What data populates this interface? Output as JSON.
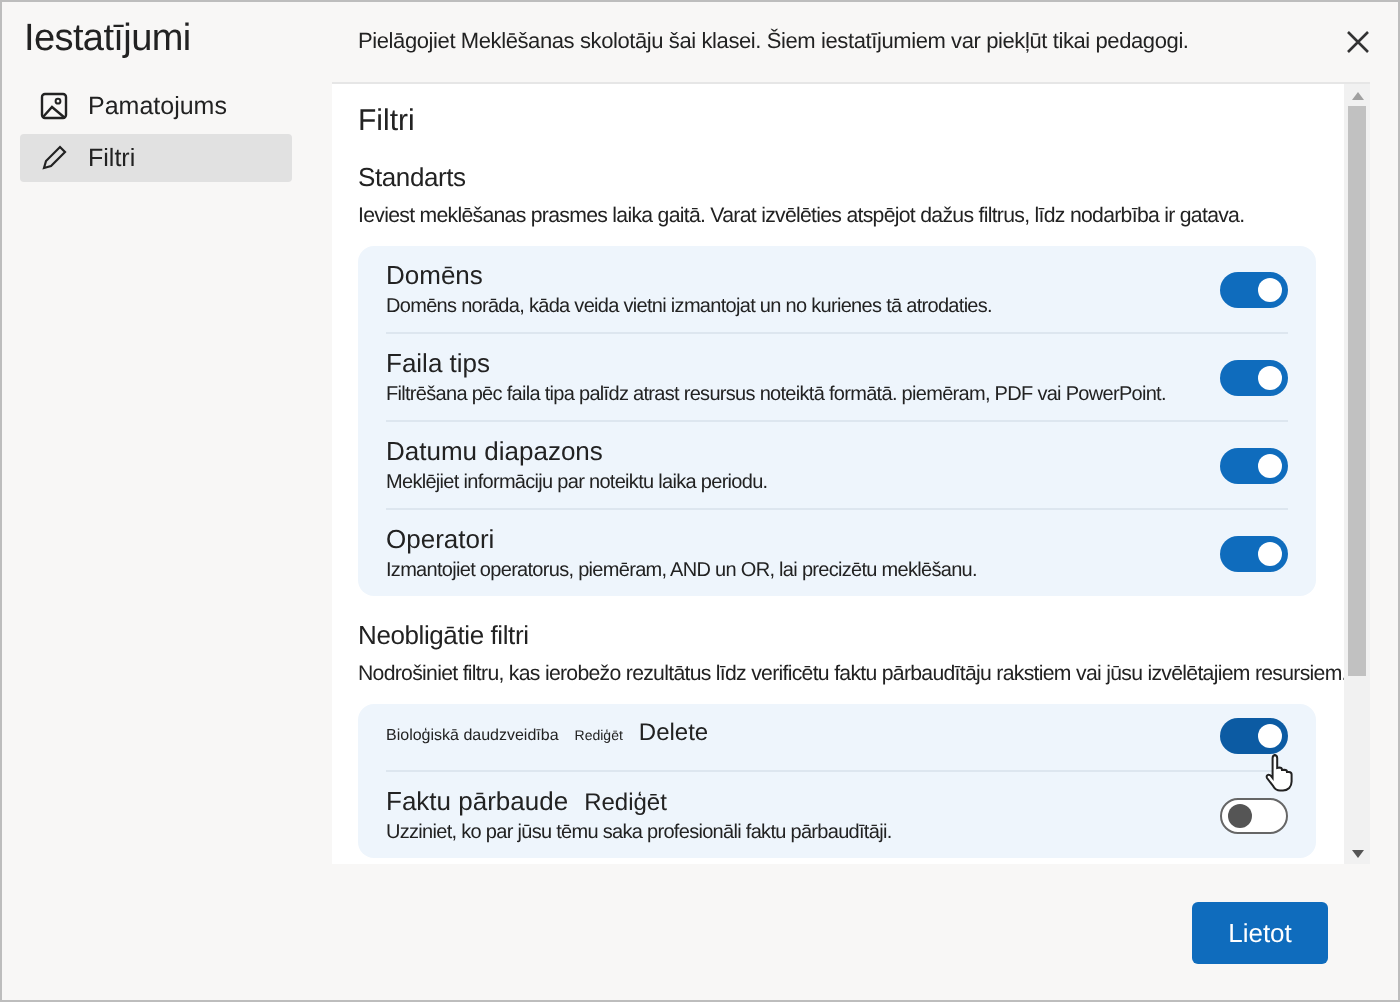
{
  "window": {
    "title": "Iestatījumi",
    "description": "Pielāgojiet Meklēšanas skolotāju šai klasei. Šiem iestatījumiem var piekļūt tikai pedagogi."
  },
  "sidebar": {
    "items": [
      {
        "label": "Pamatojums",
        "selected": false
      },
      {
        "label": "Filtri",
        "selected": true
      }
    ]
  },
  "panel": {
    "title": "Filtri",
    "sections": [
      {
        "heading": "Standarts",
        "description": "Ieviest meklēšanas prasmes laika gaitā. Varat izvēlēties atspējot dažus filtrus, līdz nodarbība ir gatava.",
        "filters": [
          {
            "title": "Domēns",
            "description": "Domēns norāda, kāda veida vietni izmantojat un no kurienes tā atrodaties.",
            "on": true,
            "hovered": false
          },
          {
            "title": "Faila tips",
            "description": "Filtrēšana pēc faila tipa palīdz atrast resursus noteiktā formātā. piemēram, PDF vai PowerPoint.",
            "on": true,
            "hovered": false
          },
          {
            "title": "Datumu diapazons",
            "description": "Meklējiet informāciju par noteiktu laika periodu.",
            "on": true,
            "hovered": false
          },
          {
            "title": "Operatori",
            "description": "Izmantojiet operatorus, piemēram, AND un OR, lai precizētu meklēšanu.",
            "on": true,
            "hovered": false
          }
        ]
      },
      {
        "heading": "Neobligātie filtri",
        "description": "Nodrošiniet filtru, kas ierobežo rezultātus līdz verificētu faktu pārbaudītāju rakstiem vai jūsu izvēlētajiem resursiem.",
        "filters": [
          {
            "title": "Bioloģiskā daudzveidība",
            "actions": [
              {
                "label": "Rediģēt",
                "kind": "tiny"
              },
              {
                "label": "Delete",
                "kind": "normal"
              }
            ],
            "on": true,
            "hovered": true
          },
          {
            "title": "Faktu pārbaude",
            "actions": [
              {
                "label": "Rediģēt",
                "kind": "normal"
              }
            ],
            "description": "Uzziniet, ko par jūsu tēmu saka profesionāli faktu pārbaudītāji.",
            "on": false,
            "hovered": false
          }
        ]
      }
    ]
  },
  "buttons": [
    {
      "label": "Lietot"
    }
  ]
}
